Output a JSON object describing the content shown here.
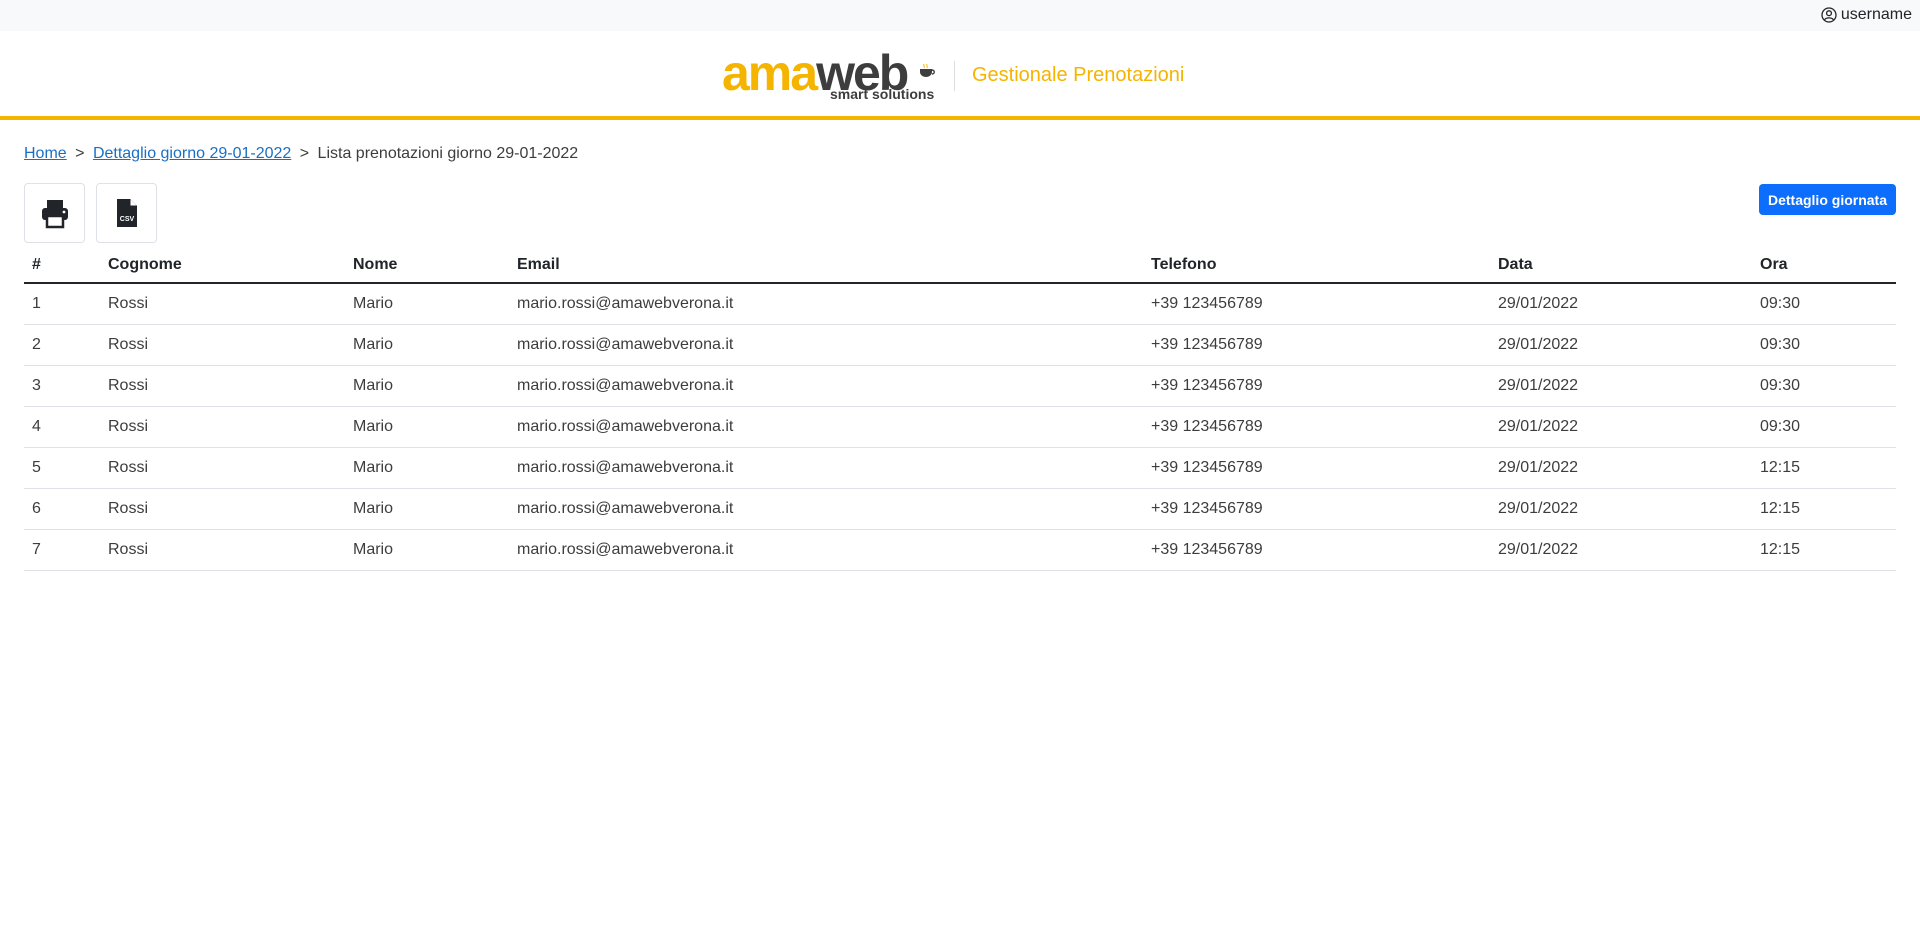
{
  "topbar": {
    "username": "username",
    "user_icon": "user-circle-icon"
  },
  "header": {
    "logo_ama": "ama",
    "logo_web": "web",
    "logo_sub": "smart solutions",
    "title": "Gestionale Prenotazioni",
    "accent_color": "#f4b400"
  },
  "breadcrumb": {
    "home": "Home",
    "sep1": ">",
    "detail": "Dettaglio giorno 29-01-2022",
    "sep2": ">",
    "current": "Lista prenotazioni giorno 29-01-2022"
  },
  "toolbar": {
    "print_icon": "printer-icon",
    "csv_icon": "csv-file-icon",
    "detail_button": "Dettaglio giornata",
    "button_color": "#0d6efd"
  },
  "table": {
    "columns": [
      "#",
      "Cognome",
      "Nome",
      "Email",
      "Telefono",
      "Data",
      "Ora"
    ],
    "rows": [
      [
        "1",
        "Rossi",
        "Mario",
        "mario.rossi@amawebverona.it",
        "+39 123456789",
        "29/01/2022",
        "09:30"
      ],
      [
        "2",
        "Rossi",
        "Mario",
        "mario.rossi@amawebverona.it",
        "+39 123456789",
        "29/01/2022",
        "09:30"
      ],
      [
        "3",
        "Rossi",
        "Mario",
        "mario.rossi@amawebverona.it",
        "+39 123456789",
        "29/01/2022",
        "09:30"
      ],
      [
        "4",
        "Rossi",
        "Mario",
        "mario.rossi@amawebverona.it",
        "+39 123456789",
        "29/01/2022",
        "09:30"
      ],
      [
        "5",
        "Rossi",
        "Mario",
        "mario.rossi@amawebverona.it",
        "+39 123456789",
        "29/01/2022",
        "12:15"
      ],
      [
        "6",
        "Rossi",
        "Mario",
        "mario.rossi@amawebverona.it",
        "+39 123456789",
        "29/01/2022",
        "12:15"
      ],
      [
        "7",
        "Rossi",
        "Mario",
        "mario.rossi@amawebverona.it",
        "+39 123456789",
        "29/01/2022",
        "12:15"
      ]
    ]
  }
}
